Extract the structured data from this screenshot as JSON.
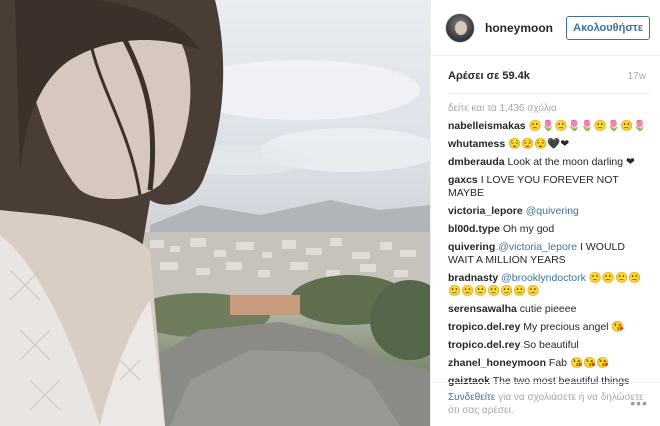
{
  "post": {
    "username": "honeymoon",
    "follow_label": "Ακολουθήστε",
    "likes": "Αρέσει σε 59.4k",
    "time": "17w",
    "view_all": "δείτε και τα 1,436 σχόλια"
  },
  "comments": [
    {
      "user": "nabelleismakas",
      "text": " 🙂🌷🙂🌷🌷🙂🌷🙂🌷"
    },
    {
      "user": "whutamess",
      "text": " 😌😌😌🖤❤"
    },
    {
      "user": "dmberauda",
      "text": " Look at the moon darling ❤"
    },
    {
      "user": "gaxcs",
      "text": " I LOVE YOU FOREVER NOT MAYBE"
    },
    {
      "user": "victoria_lepore",
      "mention": "@quivering",
      "text": ""
    },
    {
      "user": "bl00d.type",
      "text": " Oh my god"
    },
    {
      "user": "quivering",
      "mention": "@victoria_lepore",
      "text": " I WOULD WAIT A MILLION YEARS"
    },
    {
      "user": "bradnasty",
      "mention": "@brooklyndoctork",
      "text": " 🙂🙂🙂🙂🙂🙂🙂🙂🙂🙂🙂"
    },
    {
      "user": "serensawalha",
      "text": " cutie pieeee"
    },
    {
      "user": "tropico.del.rey",
      "text": " My precious angel 😘"
    },
    {
      "user": "tropico.del.rey",
      "text": " So beautiful"
    },
    {
      "user": "zhanel_honeymoon",
      "text": " Fab 😘😘😘"
    },
    {
      "user": "gaiztaok",
      "text": " The two most beautiful things"
    }
  ],
  "footer": {
    "login_link": "Συνδεθείτε",
    "text": " για να σχολιάσετε ή να δηλώσετε ότι σας αρέσει.",
    "more": "•••"
  },
  "icons": {
    "more": "more-options-icon"
  },
  "colors": {
    "link": "#3f729b",
    "muted": "#a5a7aa",
    "text": "#262626"
  }
}
